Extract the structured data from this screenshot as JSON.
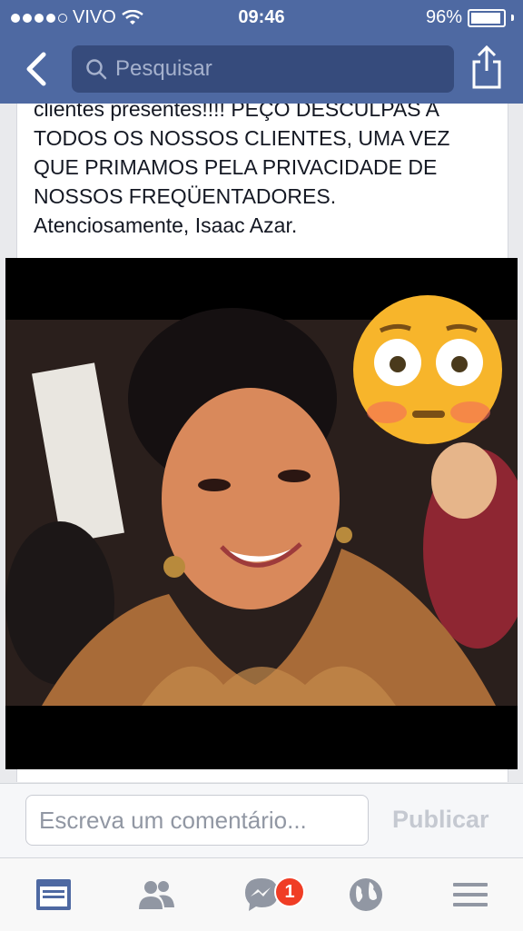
{
  "status_bar": {
    "carrier": "VIVO",
    "time": "09:46",
    "battery": "96%"
  },
  "nav": {
    "search_placeholder": "Pesquisar"
  },
  "post": {
    "text_lines": [
      "clientes presentes!!!! PEÇO DESCULPAS A",
      "TODOS OS NOSSOS CLIENTES, UMA VEZ",
      "QUE PRIMAMOS PELA PRIVACIDADE DE",
      "NOSSOS FREQÜENTADORES.",
      "Atenciosamente, Isaac Azar."
    ]
  },
  "comment": {
    "placeholder": "Escreva um comentário...",
    "publish_label": "Publicar"
  },
  "tabbar": {
    "messages_badge": "1",
    "icons": [
      "news-feed-icon",
      "friends-icon",
      "messenger-icon",
      "globe-icon",
      "menu-icon"
    ]
  },
  "colors": {
    "header": "#4e69a2",
    "search_field": "#364b7c",
    "active_tab": "#4e69a2",
    "inactive_tab": "#9197a3",
    "badge": "#f03d25"
  }
}
